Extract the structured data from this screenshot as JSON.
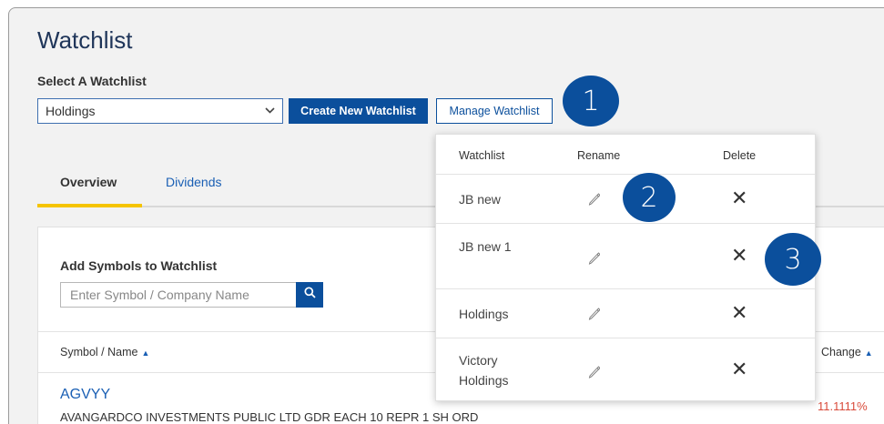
{
  "header": {
    "title": "Watchlist",
    "select_label": "Select A Watchlist"
  },
  "selector": {
    "selected": "Holdings",
    "chevron_icon": "chevron-down-icon"
  },
  "buttons": {
    "create": "Create New Watchlist",
    "manage": "Manage Watchlist"
  },
  "tabs": [
    {
      "label": "Overview",
      "active": true
    },
    {
      "label": "Dividends",
      "active": false
    }
  ],
  "add_symbols": {
    "label": "Add Symbols to Watchlist",
    "placeholder": "Enter Symbol / Company Name",
    "search_icon": "search-icon"
  },
  "table": {
    "col_symbol": "Symbol / Name",
    "col_change": "Change",
    "rows": [
      {
        "symbol": "AGVYY",
        "name": "AVANGARDCO INVESTMENTS PUBLIC LTD GDR EACH 10 REPR 1 SH ORD",
        "change": "11.1111%"
      }
    ]
  },
  "manage_dropdown": {
    "headers": [
      "Watchlist",
      "Rename",
      "Delete"
    ],
    "rows": [
      {
        "name": "JB new"
      },
      {
        "name": "JB new 1"
      },
      {
        "name": "Holdings"
      },
      {
        "name": "Victory Holdings"
      }
    ]
  },
  "callouts": [
    "1",
    "2",
    "3"
  ],
  "colors": {
    "brand": "#0b4f9c",
    "accent_tab": "#f5c400",
    "link": "#1a5fb4",
    "negative": "#d94a3a"
  }
}
